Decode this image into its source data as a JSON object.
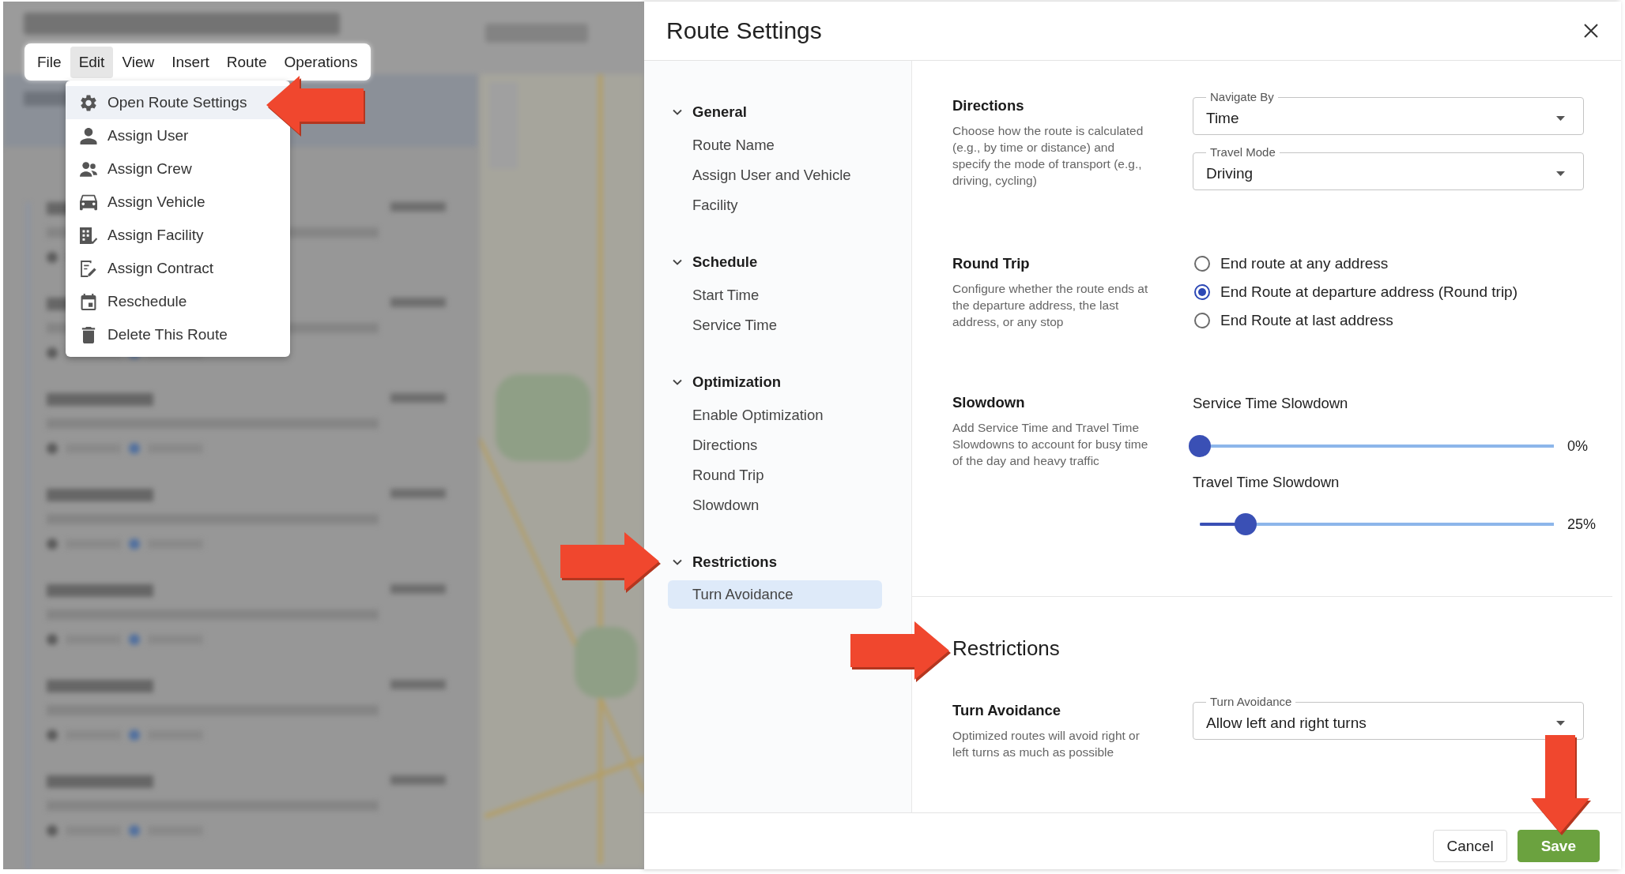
{
  "menu_bar": {
    "items": [
      {
        "label": "File",
        "selected": false
      },
      {
        "label": "Edit",
        "selected": true
      },
      {
        "label": "View",
        "selected": false
      },
      {
        "label": "Insert",
        "selected": false
      },
      {
        "label": "Route",
        "selected": false
      },
      {
        "label": "Operations",
        "selected": false
      }
    ]
  },
  "edit_menu": {
    "items": [
      {
        "label": "Open Route Settings",
        "selected": true
      },
      {
        "label": "Assign User",
        "selected": false
      },
      {
        "label": "Assign Crew",
        "selected": false
      },
      {
        "label": "Assign Vehicle",
        "selected": false
      },
      {
        "label": "Assign Facility",
        "selected": false
      },
      {
        "label": "Assign Contract",
        "selected": false
      },
      {
        "label": "Reschedule",
        "selected": false
      },
      {
        "label": "Delete This Route",
        "selected": false
      }
    ]
  },
  "dialog": {
    "title": "Route Settings",
    "nav": [
      {
        "label": "General",
        "expanded": true,
        "children": [
          {
            "label": "Route Name",
            "selected": false
          },
          {
            "label": "Assign User and Vehicle",
            "selected": false
          },
          {
            "label": "Facility",
            "selected": false
          }
        ]
      },
      {
        "label": "Schedule",
        "expanded": true,
        "children": [
          {
            "label": "Start Time",
            "selected": false
          },
          {
            "label": "Service Time",
            "selected": false
          }
        ]
      },
      {
        "label": "Optimization",
        "expanded": true,
        "children": [
          {
            "label": "Enable Optimization",
            "selected": false
          },
          {
            "label": "Directions",
            "selected": false
          },
          {
            "label": "Round Trip",
            "selected": false
          },
          {
            "label": "Slowdown",
            "selected": false
          }
        ]
      },
      {
        "label": "Restrictions",
        "expanded": true,
        "children": [
          {
            "label": "Turn Avoidance",
            "selected": true
          }
        ]
      }
    ],
    "groups": [
      {
        "rows": [
          {
            "kind": "selects",
            "title": "Directions",
            "description": "Choose how the route is calculated (e.g., by time or distance) and specify the mode of transport (e.g., driving, cycling)",
            "fields": [
              {
                "label": "Navigate By",
                "value": "Time"
              },
              {
                "label": "Travel Mode",
                "value": "Driving"
              }
            ]
          },
          {
            "kind": "radios",
            "title": "Round Trip",
            "description": "Configure whether the route ends at the departure address, the last address, or any stop",
            "options": [
              {
                "label": "End route at any address",
                "selected": false
              },
              {
                "label": "End Route at departure address (Round trip)",
                "selected": true
              },
              {
                "label": "End Route at last address",
                "selected": false
              }
            ]
          },
          {
            "kind": "sliders",
            "title": "Slowdown",
            "description": "Add Service Time and Travel Time Slowdowns to account for busy time of the day and heavy traffic",
            "sliders": [
              {
                "label": "Service Time Slowdown",
                "level": 0,
                "reading": "0%"
              },
              {
                "label": "Travel Time Slowdown",
                "level": 0.13,
                "reading": "25%"
              }
            ]
          }
        ]
      },
      {
        "title": "Restrictions",
        "rows": [
          {
            "kind": "selects",
            "title": "Turn Avoidance",
            "description": "Optimized routes will avoid right or left turns as much as possible",
            "fields": [
              {
                "label": "Turn Avoidance",
                "value": "Allow left and right turns"
              }
            ]
          }
        ]
      }
    ],
    "buttons": [
      {
        "label": "Cancel",
        "kind": "secondary"
      },
      {
        "label": "Save",
        "kind": "primary"
      }
    ]
  }
}
